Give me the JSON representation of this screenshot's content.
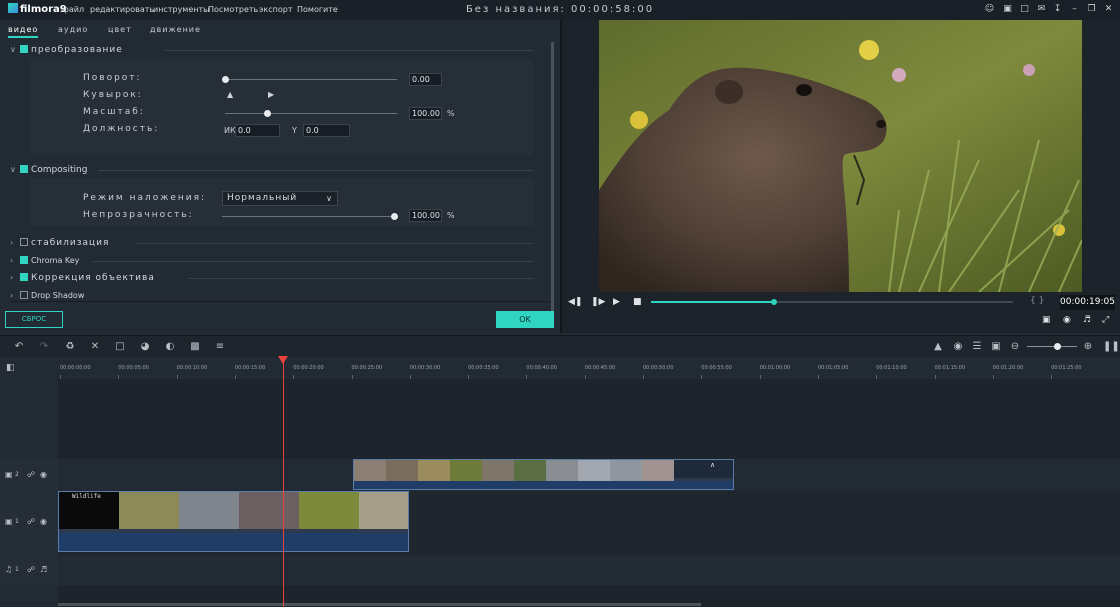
{
  "app": {
    "logo": "filmora9",
    "title": "Без названия: 00:00:58:00",
    "menu": [
      "файл",
      "редактировать",
      "инструменты",
      "Посмотреть",
      "экспорт",
      "Помогите"
    ]
  },
  "tabs": [
    "видео",
    "аудио",
    "цвет",
    "движение"
  ],
  "transform": {
    "header": "преобразование",
    "rotate_label": "Поворот:",
    "rotate_value": "0.00",
    "flip_label": "Кувырок:",
    "scale_label": "Масштаб:",
    "scale_value": "100.00",
    "scale_unit": "%",
    "position_label": "Должность:",
    "pos_x_label": "ИКС",
    "pos_x_value": "0.0",
    "pos_y_label": "Y",
    "pos_y_value": "0.0"
  },
  "compositing": {
    "header": "Compositing",
    "blend_label": "Режим наложения:",
    "blend_value": "Нормальный",
    "opacity_label": "Непрозрачность:",
    "opacity_value": "100.00",
    "opacity_unit": "%"
  },
  "sections": {
    "stabilization": "стабилизация",
    "chroma_key": "Chroma Key",
    "lens_correction": "Коррекция объектива",
    "drop_shadow": "Drop Shadow"
  },
  "buttons": {
    "reset": "СБРОС",
    "ok": "OK"
  },
  "preview": {
    "timecode": "00:00:19:05",
    "braces": "{ }",
    "progress": 0.34
  },
  "ruler": {
    "labels": [
      "00:00:00:00",
      "00:00:05:00",
      "00:00:10:00",
      "00:00:15:00",
      "00:00:20:00",
      "00:00:25:00",
      "00:00:30:00",
      "00:00:35:00",
      "00:00:40:00",
      "00:00:45:00",
      "00:00:50:00",
      "00:00:55:00",
      "00:01:00:00",
      "00:01:05:00",
      "00:01:10:00",
      "00:01:15:00",
      "00:01:20:00",
      "00:01:25:00"
    ]
  },
  "tracks": {
    "video2": "2",
    "video1": "1",
    "audio1": "1",
    "clip_title": "Wildlife"
  },
  "colors": {
    "accent": "#2fd5c0",
    "playhead": "#e8413b",
    "clip_border": "#5a7ca8"
  }
}
